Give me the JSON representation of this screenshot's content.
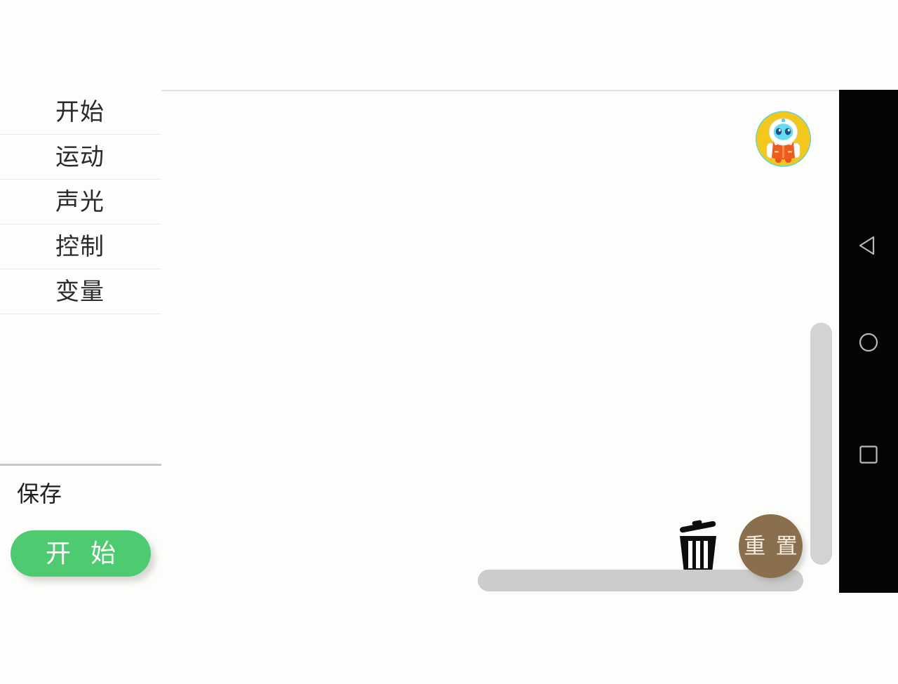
{
  "app": {
    "background_color": "#fdfdfb",
    "accent_green": "#4ecb71",
    "accent_brown": "#8a6f4e"
  },
  "sidebar": {
    "items": [
      {
        "label": "开始",
        "name": "start"
      },
      {
        "label": "运动",
        "name": "motion"
      },
      {
        "label": "声光",
        "name": "sound-light"
      },
      {
        "label": "控制",
        "name": "control"
      },
      {
        "label": "变量",
        "name": "variable"
      }
    ],
    "save_label": "保存",
    "start_button_label": "开 始"
  },
  "workspace": {
    "avatar_icon": "robot-avatar-icon",
    "trash_icon": "trash-can-icon",
    "reset_button_label": "重 置",
    "vertical_scrollbar": "vertical-scrollbar",
    "horizontal_scrollbar": "horizontal-scrollbar",
    "blocks": []
  },
  "android_navbar": {
    "back_icon": "back-triangle-icon",
    "home_icon": "home-circle-icon",
    "recents_icon": "recents-square-icon"
  }
}
